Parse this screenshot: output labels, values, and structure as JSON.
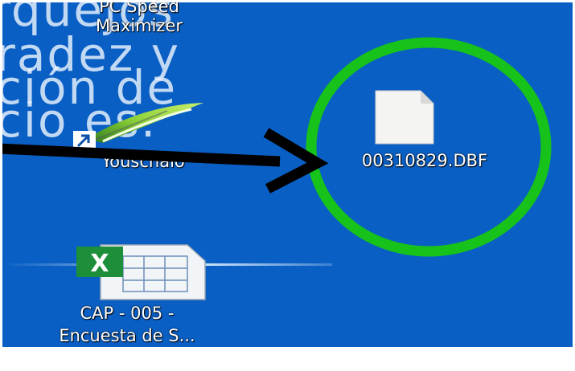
{
  "wallpaper": {
    "lines": [
      "rquejos",
      "radez y",
      "ción de",
      "cio   es."
    ]
  },
  "desktop_icons": [
    {
      "name": "pc-speed-maximizer",
      "label_line1": "PC Speed",
      "label_line2": "Maximizer",
      "icon": "pc-speed-icon"
    },
    {
      "name": "youschalo",
      "label": "Youschalo",
      "icon": "shortcut-app-icon"
    },
    {
      "name": "dbf-file",
      "label": "00310829.DBF",
      "icon": "blank-file-icon"
    },
    {
      "name": "excel-file",
      "label_line1": "CAP - 005 -",
      "label_line2": "Encuesta de S...",
      "icon": "excel-file-icon"
    }
  ],
  "annotations": {
    "arrow_color": "#000000",
    "circle_color": "#17c21a"
  },
  "colors": {
    "desktop_bg": "#0a5fc4",
    "border": "#ffffff"
  }
}
